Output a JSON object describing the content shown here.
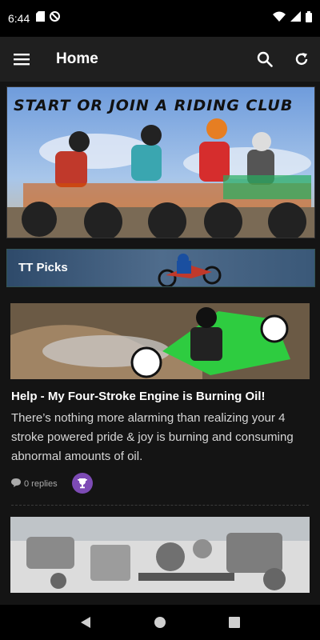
{
  "status_bar": {
    "time": "6:44",
    "left_icons": [
      "sd-card-icon",
      "no-disturb-icon"
    ],
    "right_icons": [
      "wifi-icon",
      "signal-icon",
      "battery-icon"
    ]
  },
  "app_bar": {
    "title": "Home",
    "menu_icon": "hamburger-menu-icon",
    "actions": [
      "search-icon",
      "refresh-icon"
    ]
  },
  "banner": {
    "text": "START OR JOIN A RIDING CLUB"
  },
  "picks_section": {
    "label": "TT Picks"
  },
  "posts": [
    {
      "title": "Help - My Four-Stroke Engine is Burning Oil!",
      "excerpt": "There’s nothing more alarming than realizing your 4 stroke powered pride & joy is burning and consuming abnormal amounts of oil.",
      "replies": "0 replies",
      "badge_icon": "trophy-icon"
    },
    {
      "title": "",
      "excerpt": "",
      "replies": ""
    }
  ],
  "colors": {
    "app_bar_bg": "#1f1f1f",
    "content_bg": "#141414",
    "badge_purple": "#7d4bb5"
  }
}
